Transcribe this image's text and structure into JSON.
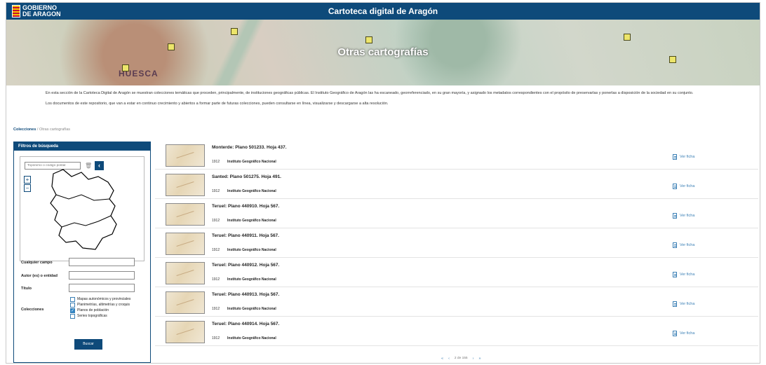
{
  "header": {
    "logo_text_1": "GOBIERNO",
    "logo_text_2": "DE ARAGON",
    "title": "Cartoteca digital de Aragón"
  },
  "hero": {
    "title": "Otras cartografías",
    "place": "HUESCA"
  },
  "intro": {
    "p1": "En esta sección de la Cartoteca Digital de Aragón se muestran colecciones temáticas que proceden, principalmente, de instituciones geográficas públicas. El Instituto Geográfico de Aragón las ha escaneado, georreferenciado, en su gran mayoría, y asignado los metadatos correspondientes con el propósito de preservarlas y ponerlas a disposición de la sociedad en su conjunto.",
    "p2": "Los documentos de este repositorio, que van a estar en continuo crecimiento y abiertos a formar parte de futuras colecciones, pueden consultarse en línea, visualizarse y descargarse a alta resolución."
  },
  "breadcrumb": {
    "root": "Colecciones",
    "sep": " / ",
    "current": "Otras cartografías"
  },
  "sidebar": {
    "title": "Filtros de búsqueda",
    "map": {
      "search_placeholder": "Topónimo o código postal",
      "back_glyph": "‹",
      "zoom_in": "+",
      "zoom_out": "−",
      "trash_glyph": "🗑"
    },
    "fields": {
      "any_label": "Cualquier campo",
      "author_label": "Autor (es) o entidad",
      "title_label": "Título",
      "collections_label": "Colecciones"
    },
    "collections": [
      {
        "label": "Mapas autonómicos y provinciales",
        "checked": false
      },
      {
        "label": "Planimetrías, altimetrías y croquis",
        "checked": false
      },
      {
        "label": "Planos de población",
        "checked": true
      },
      {
        "label": "Series topográficas",
        "checked": false
      }
    ],
    "search_button": "Buscar"
  },
  "results": [
    {
      "title": "Monterde: Plano 501233. Hoja 437.",
      "year": "1912",
      "author": "Instituto Geográfico Nacional",
      "link": "Ver ficha"
    },
    {
      "title": "Santed: Plano 501275. Hoja 491.",
      "year": "1912",
      "author": "Instituto Geográfico Nacional",
      "link": "Ver ficha"
    },
    {
      "title": "Teruel: Plano 440910. Hoja 567.",
      "year": "1912",
      "author": "Instituto Geográfico Nacional",
      "link": "Ver ficha"
    },
    {
      "title": "Teruel: Plano 440911. Hoja 567.",
      "year": "1912",
      "author": "Instituto Geográfico Nacional",
      "link": "Ver ficha"
    },
    {
      "title": "Teruel: Plano 440912. Hoja 567.",
      "year": "1912",
      "author": "Instituto Geográfico Nacional",
      "link": "Ver ficha"
    },
    {
      "title": "Teruel: Plano 440913. Hoja 567.",
      "year": "1912",
      "author": "Instituto Geográfico Nacional",
      "link": "Ver ficha"
    },
    {
      "title": "Teruel: Plano 440914. Hoja 567.",
      "year": "1912",
      "author": "Instituto Geográfico Nacional",
      "link": "Ver ficha"
    }
  ],
  "pagination": {
    "first": "«",
    "prev": "‹",
    "info": "2 de 155",
    "next": "›",
    "last": "»"
  },
  "colors": {
    "primary": "#0e4a7a",
    "accent": "#3a7fb5",
    "checkbox_checked": "#2e86c8"
  },
  "icons": [
    "trash-icon",
    "back-icon",
    "document-icon",
    "pager-first-icon",
    "pager-prev-icon",
    "pager-next-icon",
    "pager-last-icon"
  ]
}
